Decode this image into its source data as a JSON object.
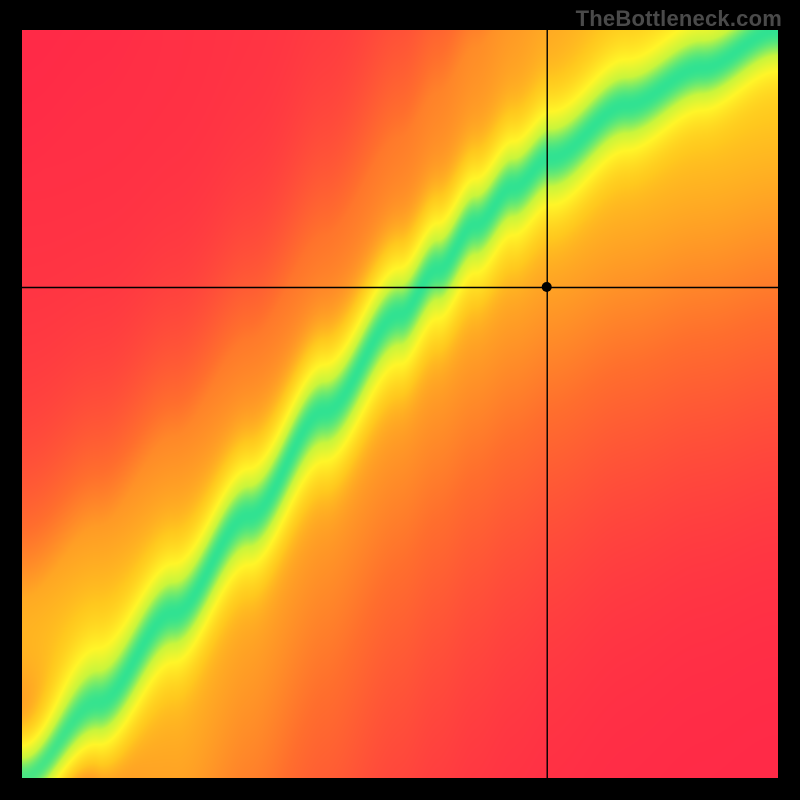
{
  "watermark": "TheBottleneck.com",
  "chart_data": {
    "type": "heatmap",
    "title": "",
    "xlabel": "",
    "ylabel": "",
    "xlim": [
      0,
      100
    ],
    "ylim": [
      0,
      100
    ],
    "grid": false,
    "crosshair": {
      "x": 69.5,
      "y": 65.6
    },
    "marker": {
      "x": 69.5,
      "y": 65.6,
      "radius": 5,
      "fill": "#000000"
    },
    "colormap": {
      "stops": [
        {
          "t": 0.0,
          "rgb": [
            255,
            39,
            72
          ]
        },
        {
          "t": 0.25,
          "rgb": [
            255,
            110,
            45
          ]
        },
        {
          "t": 0.5,
          "rgb": [
            255,
            200,
            30
          ]
        },
        {
          "t": 0.7,
          "rgb": [
            255,
            245,
            40
          ]
        },
        {
          "t": 0.85,
          "rgb": [
            200,
            245,
            60
          ]
        },
        {
          "t": 1.0,
          "rgb": [
            40,
            225,
            150
          ]
        }
      ]
    },
    "ridge": {
      "comment": "y = f(x) center of green band, in 0..100 domain",
      "points": [
        {
          "x": 0,
          "y": 0
        },
        {
          "x": 10,
          "y": 10
        },
        {
          "x": 20,
          "y": 22
        },
        {
          "x": 30,
          "y": 35
        },
        {
          "x": 40,
          "y": 49
        },
        {
          "x": 50,
          "y": 62
        },
        {
          "x": 55,
          "y": 68
        },
        {
          "x": 60,
          "y": 74
        },
        {
          "x": 65,
          "y": 79
        },
        {
          "x": 70,
          "y": 83
        },
        {
          "x": 80,
          "y": 90
        },
        {
          "x": 90,
          "y": 95
        },
        {
          "x": 100,
          "y": 100
        }
      ],
      "sigma_vertical": 6.0,
      "diag_sigma": 45.0
    }
  }
}
